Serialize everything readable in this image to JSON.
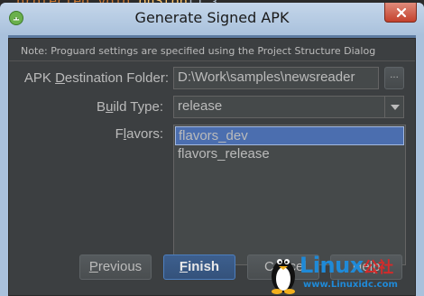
{
  "editor": {
    "code_keyword1": "protected",
    "code_keyword2": "void",
    "code_fn": "onStop",
    "code_tail": "() {"
  },
  "window": {
    "title": "Generate Signed APK",
    "close_icon": "close-icon",
    "app_icon": "android-studio-icon"
  },
  "dialog": {
    "note": "Note: Proguard settings are specified using the Project Structure Dialog",
    "dest_label_pre": "APK ",
    "dest_label_ul": "D",
    "dest_label_post": "estination Folder:",
    "dest_value": "D:\\Work\\samples\\newsreader",
    "browse_label": "...",
    "build_label_pre": "B",
    "build_label_ul": "u",
    "build_label_post": "ild Type:",
    "build_value": "release",
    "flavors_label_pre": "F",
    "flavors_label_ul": "l",
    "flavors_label_post": "avors:",
    "flavors": [
      "flavors_dev",
      "flavors_release"
    ],
    "selected_flavor_index": 0
  },
  "buttons": {
    "previous_ul": "P",
    "previous_rest": "revious",
    "finish_ul": "F",
    "finish_rest": "inish",
    "cancel_visible": "Ca",
    "cancel_hidden_rest": "ncel",
    "help": "Help"
  },
  "watermark": {
    "brand": "Linux",
    "brand_cn": "公社",
    "url": "www.Linuxidc.com"
  },
  "colors": {
    "title_bar": "#b8cde5",
    "dialog_bg": "#3c3f41",
    "selection": "#4b6eaf",
    "primary_button": "#3d5f8e",
    "close_button": "#c4412c"
  }
}
